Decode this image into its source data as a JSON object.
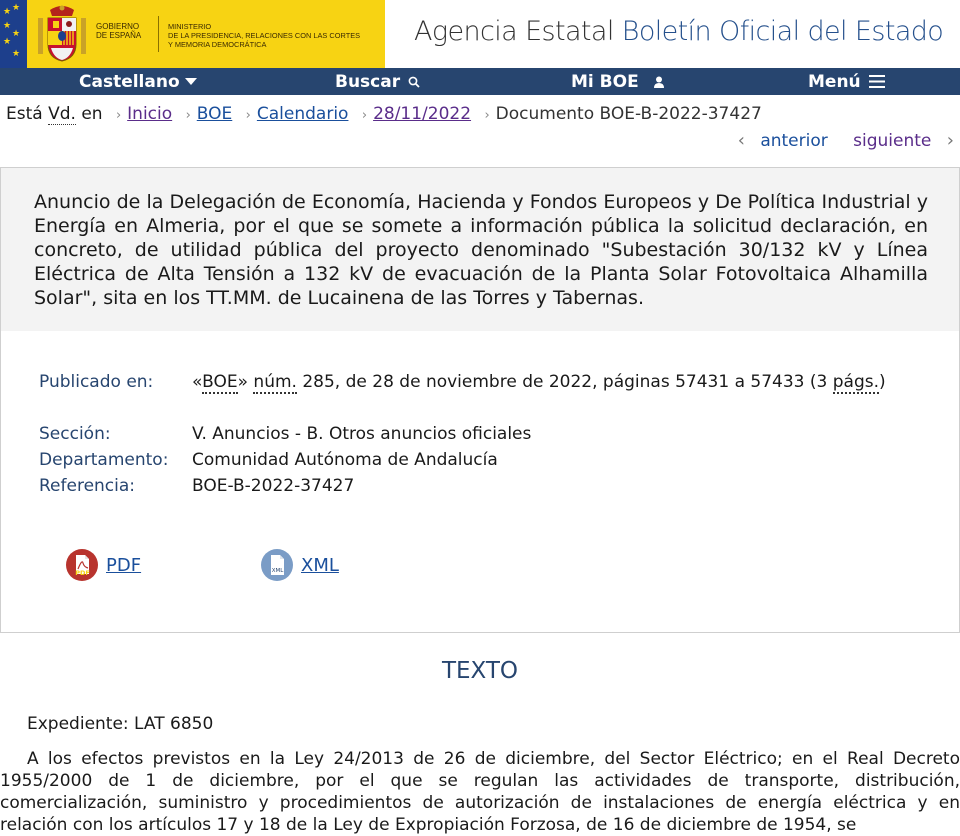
{
  "header": {
    "gov_line1": "Gobierno",
    "gov_line2": "de España",
    "ministry_line1": "Ministerio",
    "ministry_line2": "de la Presidencia, Relaciones con las Cortes",
    "ministry_line3": "y Memoria Democrática",
    "agency_part1": "Agencia Estatal",
    "agency_part2": "Boletín Oficial del Estado",
    "accent_color": "#27456f",
    "gov_color": "#f7d313"
  },
  "nav": {
    "language": "Castellano",
    "search": "Buscar",
    "my_boe": "Mi BOE",
    "menu": "Menú"
  },
  "breadcrumb": {
    "prefix_esta": "Está",
    "prefix_vd": "Vd.",
    "prefix_en": "en",
    "items": [
      "Inicio",
      "BOE",
      "Calendario",
      "28/11/2022"
    ],
    "current": "Documento BOE-B-2022-37427"
  },
  "pager": {
    "previous": "anterior",
    "next": "siguiente"
  },
  "document": {
    "title": "Anuncio de la Delegación de Economía, Hacienda y Fondos Europeos y De Política Industrial y Energía en Almeria, por el que se somete a información pública la solicitud declaración, en concreto, de utilidad pública del proyecto denominado \"Subestación 30/132 kV y Línea Eléctrica de Alta Tensión a 132 kV de evacuación de la Planta Solar Fotovoltaica Alhamilla Solar\", sita en los TT.MM. de Lucainena de las Torres y Tabernas."
  },
  "metadata": {
    "published_label": "Publicado en:",
    "published_quote_open": "«",
    "published_boe": "BOE",
    "published_quote_close": "»",
    "published_num": "núm.",
    "published_rest": "285, de 28 de noviembre de 2022, páginas 57431 a 57433 (3",
    "published_pags": "págs.",
    "published_close": ")",
    "section_label": "Sección:",
    "section_value": "V. Anuncios - B. Otros anuncios oficiales",
    "department_label": "Departamento:",
    "department_value": "Comunidad Autónoma de Andalucía",
    "reference_label": "Referencia:",
    "reference_value": "BOE-B-2022-37427"
  },
  "downloads": {
    "pdf": "PDF",
    "xml": "XML",
    "pdf_icon_text": "PDF",
    "xml_icon_text": "XML"
  },
  "body": {
    "section_title": "TEXTO",
    "expediente": "Expediente: LAT 6850",
    "paragraph1": "A los efectos previstos en la Ley 24/2013 de 26 de diciembre, del Sector Eléctrico; en el Real Decreto 1955/2000 de 1 de diciembre, por el que se regulan las actividades de transporte, distribución, comercialización, suministro y procedimientos de autorización de instalaciones de energía eléctrica y en relación con los artículos 17 y 18 de la Ley de Expropiación Forzosa, de 16 de diciembre de 1954, se"
  }
}
